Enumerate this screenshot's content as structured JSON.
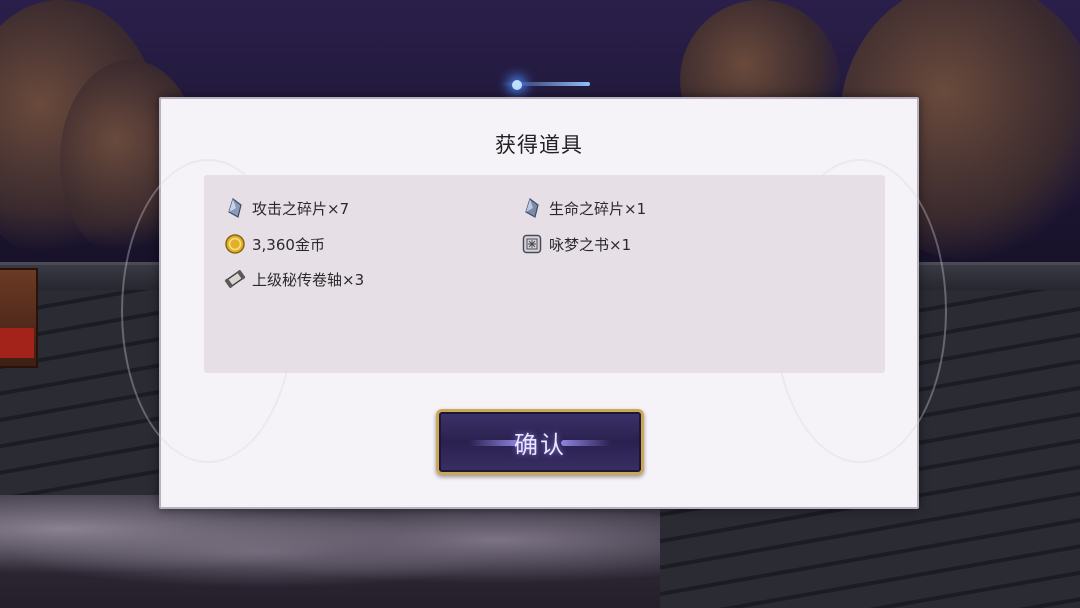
{
  "dialog": {
    "title": "获得道具",
    "confirm_label": "确认"
  },
  "items": [
    {
      "label": "攻击之碎片×7",
      "icon": "crystal-shard-icon"
    },
    {
      "label": "生命之碎片×1",
      "icon": "crystal-shard-icon"
    },
    {
      "label": "3,360金币",
      "icon": "gold-coin-icon"
    },
    {
      "label": "咏梦之书×1",
      "icon": "book-icon"
    },
    {
      "label": "上级秘传卷轴×3",
      "icon": "scroll-icon"
    }
  ],
  "colors": {
    "panel_bg": "#e6dfe6",
    "dialog_bg": "#f6f3f8",
    "button_bg": "#2a2150",
    "button_border": "#c9a857"
  }
}
